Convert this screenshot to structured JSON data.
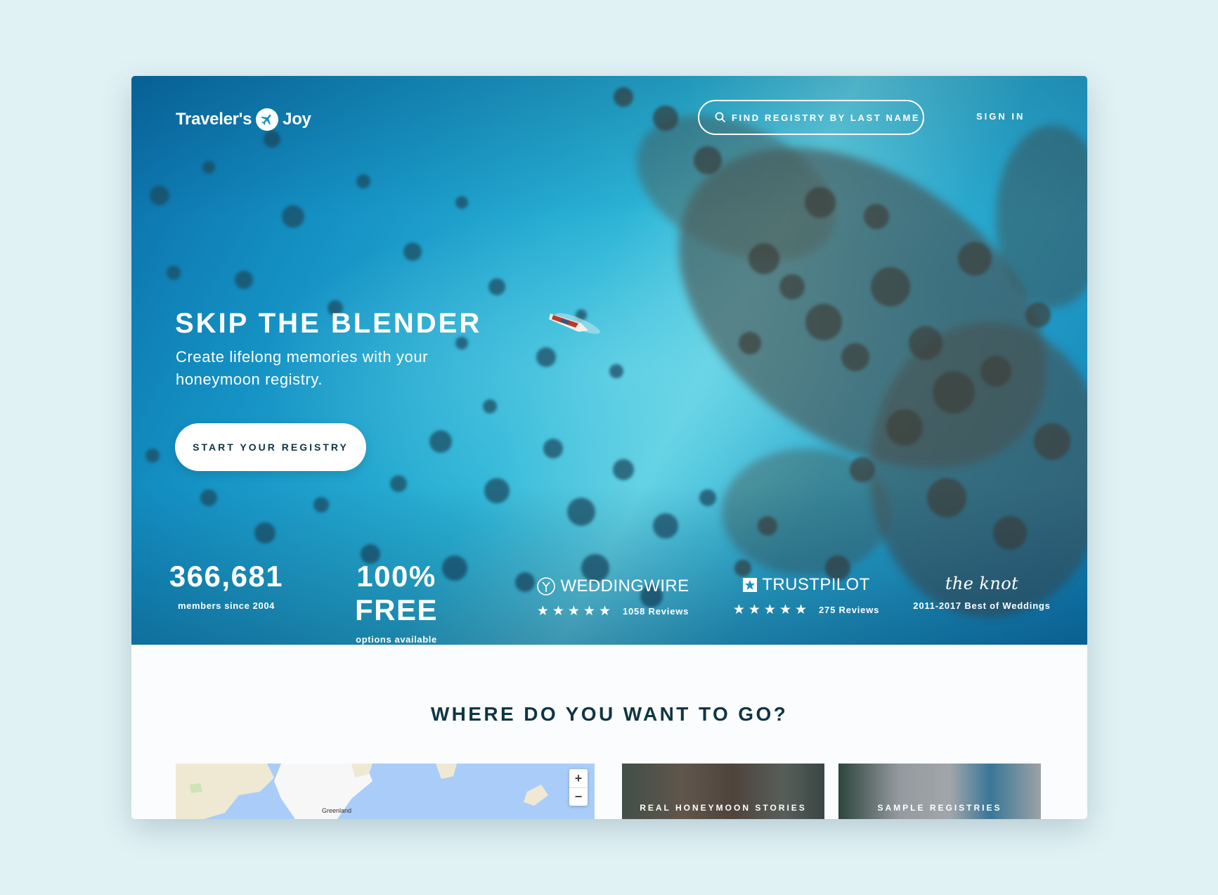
{
  "header": {
    "logo": {
      "left": "Traveler's",
      "right": "Joy"
    },
    "search_placeholder": "FIND REGISTRY BY LAST NAME",
    "signin": "SIGN IN"
  },
  "hero": {
    "title": "SKIP THE BLENDER",
    "subtitle": "Create lifelong memories with your honeymoon registry.",
    "cta": "START YOUR REGISTRY"
  },
  "stats": [
    {
      "value": "366,681",
      "label": "members since 2004"
    },
    {
      "value": "100% FREE",
      "label": "options available"
    }
  ],
  "trust": {
    "weddingwire": {
      "name": "WEDDINGWIRE",
      "stars": "★★★★★",
      "reviews": "1058 Reviews"
    },
    "trustpilot": {
      "name": "TRUSTPILOT",
      "stars": "★★★★★",
      "reviews": "275 Reviews"
    },
    "knot": {
      "name": "the knot",
      "caption": "2011-2017 Best of Weddings"
    }
  },
  "destinations": {
    "title": "WHERE DO YOU WANT TO GO?",
    "map_label": "Greenland",
    "zoom_in": "+",
    "zoom_out": "−",
    "cards": [
      {
        "label": "REAL HONEYMOON STORIES"
      },
      {
        "label": "SAMPLE REGISTRIES"
      }
    ]
  },
  "colors": {
    "page_bg": "#e1f2f5",
    "navy_text": "#103544",
    "ocean": "#1592c4",
    "map_water": "#a9cdf8"
  }
}
